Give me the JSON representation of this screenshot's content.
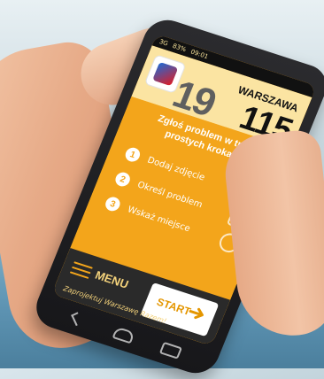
{
  "phone": {
    "status_time": "09:01",
    "status_battery": "83%",
    "status_signal": "3G"
  },
  "app": {
    "city": "WARSZAWA",
    "big_number_left": "19",
    "big_number_right": "115",
    "heading": "Zgłoś problem w trzech prostych krokach:",
    "steps": [
      {
        "n": "1",
        "label": "Dodaj zdjęcie"
      },
      {
        "n": "2",
        "label": "Określ problem"
      },
      {
        "n": "3",
        "label": "Wskaż miejsce"
      }
    ],
    "menu_label": "MENU",
    "start_label": "START",
    "sponsor_text": "Zaprojektuj Warszawę Razem!"
  }
}
